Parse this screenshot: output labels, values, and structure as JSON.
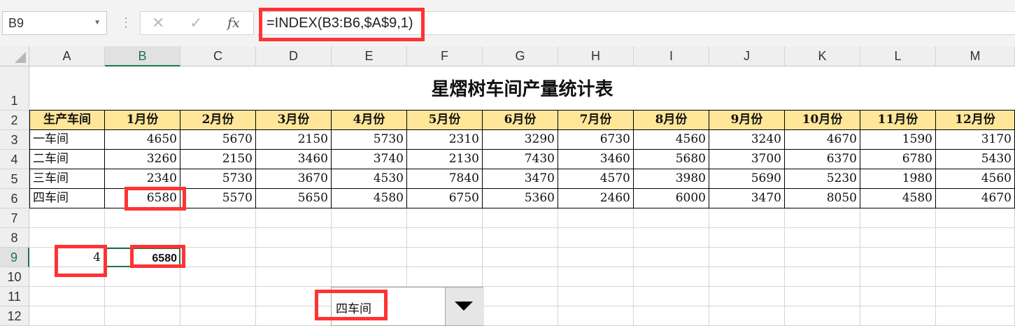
{
  "formula_bar": {
    "name_box": "B9",
    "formula": "=INDEX(B3:B6,$A$9,1)",
    "cancel_icon": "✕",
    "enter_icon": "✓",
    "fx_label": "fx"
  },
  "columns": [
    "A",
    "B",
    "C",
    "D",
    "E",
    "F",
    "G",
    "H",
    "I",
    "J",
    "K",
    "L",
    "M"
  ],
  "rows": [
    "1",
    "2",
    "3",
    "4",
    "5",
    "6",
    "7",
    "8",
    "9",
    "10",
    "11",
    "12"
  ],
  "sheet": {
    "title": "星熠树车间产量统计表",
    "headers": [
      "生产车间",
      "1月份",
      "2月份",
      "3月份",
      "4月份",
      "5月份",
      "6月份",
      "7月份",
      "8月份",
      "9月份",
      "10月份",
      "11月份",
      "12月份"
    ],
    "data": [
      [
        "一车间",
        "4650",
        "5670",
        "2150",
        "5730",
        "2310",
        "3290",
        "6730",
        "4560",
        "3240",
        "4670",
        "1590",
        "3170"
      ],
      [
        "二车间",
        "3260",
        "2150",
        "3460",
        "3740",
        "2130",
        "7430",
        "3460",
        "5680",
        "3700",
        "6370",
        "6780",
        "5430"
      ],
      [
        "三车间",
        "2340",
        "5730",
        "3670",
        "4530",
        "7840",
        "3470",
        "4570",
        "3980",
        "5690",
        "5230",
        "1980",
        "4560"
      ],
      [
        "四车间",
        "6580",
        "5570",
        "5650",
        "4580",
        "6750",
        "5360",
        "2460",
        "6000",
        "3470",
        "8050",
        "4580",
        "4670"
      ]
    ],
    "a9": "4",
    "b9": "6580"
  },
  "combo": {
    "selected": "四车间"
  },
  "colors": {
    "header_fill": "#ffe699",
    "highlight": "#ff3333",
    "excel_green": "#217346"
  }
}
